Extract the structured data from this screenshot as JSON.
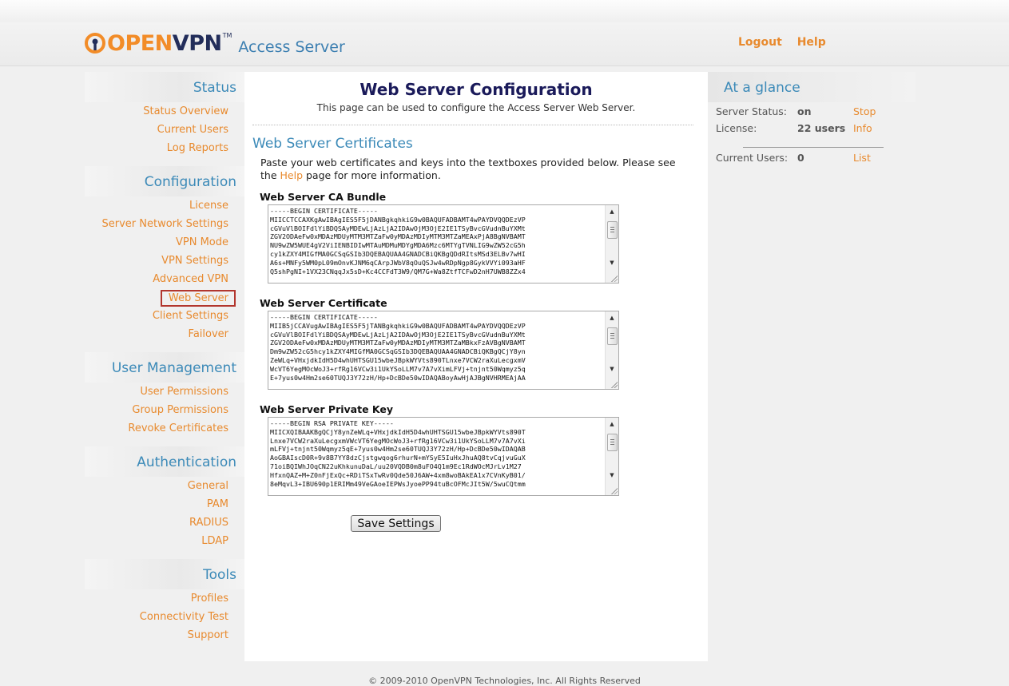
{
  "header": {
    "logo_open": "OPEN",
    "logo_vpn": "VPN",
    "logo_tm": "TM",
    "logo_product": "Access Server",
    "logout": "Logout",
    "help": "Help"
  },
  "sidebar": {
    "sections": [
      {
        "title": "Status",
        "items": [
          "Status Overview",
          "Current Users",
          "Log Reports"
        ]
      },
      {
        "title": "Configuration",
        "items": [
          "License",
          "Server Network Settings",
          "VPN Mode",
          "VPN Settings",
          "Advanced VPN",
          "Web Server",
          "Client Settings",
          "Failover"
        ]
      },
      {
        "title": "User Management",
        "items": [
          "User Permissions",
          "Group Permissions",
          "Revoke Certificates"
        ]
      },
      {
        "title": "Authentication",
        "items": [
          "General",
          "PAM",
          "RADIUS",
          "LDAP"
        ]
      },
      {
        "title": "Tools",
        "items": [
          "Profiles",
          "Connectivity Test",
          "Support"
        ]
      }
    ],
    "active_item": "Web Server"
  },
  "main": {
    "title": "Web Server Configuration",
    "subtitle": "This page can be used to configure the Access Server Web Server.",
    "section_title": "Web Server Certificates",
    "intro_before_link": "Paste your web certificates and keys into the textboxes provided below. Please see the ",
    "intro_link": "Help",
    "intro_after_link": " page for more information.",
    "ca_bundle_label": "Web Server CA Bundle",
    "ca_bundle_value": "-----BEGIN CERTIFICATE-----\nMIICCTCCAXKgAwIBAgIES5F5jDANBgkqhkiG9w0BAQUFADBAMT4wPAYDVQQDEzVP\ncGVuVlBOIFdlYiBDQSAyMDEwLjAzLjA2IDAwOjM3OjE2IE1TSyBvcGVudnBuYXMt\nZGV2ODAeFw0xMDAzMDUyMTM3MTZaFw0yMDAzMDIyMTM3MTZaMEAxPjA8BgNVBAMT\nNU9wZW5WUE4gV2ViIENBIDIwMTAuMDMuMDYgMDA6Mzc6MTYgTVNLIG9wZW52cG5h\ncy1kZXY4MIGfMA0GCSqGSIb3DQEBAQUAA4GNADCBiQKBgQDdRItsMSd3ELBv7wHI\nA6s+MNFy5WM0pL09mOnvKJNM6qCArpJWbV8qOuQSJw4wRDpNgp8GykVVYi093aHF\nQ5shPgNI+1VX23CNqqJx5sD+Kc4CCFdT3W9/QM7G+Wa8ZtfTCFwD2nH7UWB8ZZx4",
    "cert_label": "Web Server Certificate",
    "cert_value": "-----BEGIN CERTIFICATE-----\nMIIB5jCCAVugAwIBAgIES5F5jTANBgkqhkiG9w0BAQUFADBAMT4wPAYDVQQDEzVP\ncGVuVlBOIFdlYiBDQSAyMDEwLjAzLjA2IDAwOjM3OjE2IE1TSyBvcGVudnBuYXMt\nZGV2ODAeFw0xMDAzMDUyMTM3MTZaFw0yMDAzMDIyMTM3MTZaMBkxFzAVBgNVBAMT\nDm9wZW52cG5hcy1kZXY4MIGfMA0GCSqGSIb3DQEBAQUAA4GNADCBiQKBgQCjY8yn\nZeWLq+VHxjdkIdH5D4whUHTSGU15wbeJBpkWYVts890TLnxe7VCW2raXuLecgxmV\nWcVT6YegMOcWoJ3+rfRg16VCw3i1UkYSoLLM7v7A7vXimLFVj+tnjnt50Wqmyz5q\nE+7yus0w4Hm2se60TUQJ3Y72zH/Hp+DcBDe50wIDAQABoyAwHjAJBgNVHRMEAjAA",
    "key_label": "Web Server Private Key",
    "key_value": "-----BEGIN RSA PRIVATE KEY-----\nMIICXQIBAAKBgQCjY8ynZeWLq+VHxjdkIdH5D4whUHTSGU15wbeJBpkWYVts890T\nLnxe7VCW2raXuLecgxmVWcVT6YegMOcWoJ3+rfRg16VCw3i1UkYSoLLM7v7A7vXi\nmLFVj+tnjnt50Wqmyz5qE+7yus0w4Hm2se60TUQJ3Y72zH/Hp+DcBDe50wIDAQAB\nAoGBAIscD0R+9v8B7YY8dzCjstgwqog6rhurN+mYSyE5IuHxJhuAQ8tvCqjvuGuX\n71oiBQIWhJOqCN22uKhkunuDaL/uu20VQDB0m8uFO4Q1m9Ec1RdWOcMJrLv1M27\nHfxnQAZ+M+Z0nFjExQc+RDiTSxTwRv0Qde50J6AW+4xm8woBAkEA1x7CVnKyB01/\n8eMqvL3+IBU690p1ERIMm49VeGAoeIEPWsJyoePP94tuBcOFMcJIt5W/5wuCQtmm",
    "save_button": "Save Settings"
  },
  "glance": {
    "title": "At a glance",
    "server_status_label": "Server Status:",
    "server_status_value": "on",
    "server_status_action": "Stop",
    "license_label": "License:",
    "license_value": "22 users",
    "license_action": "Info",
    "current_users_label": "Current Users:",
    "current_users_value": "0",
    "current_users_action": "List"
  },
  "footer": {
    "text": "© 2009-2010 OpenVPN Technologies, Inc.     All Rights Reserved"
  }
}
